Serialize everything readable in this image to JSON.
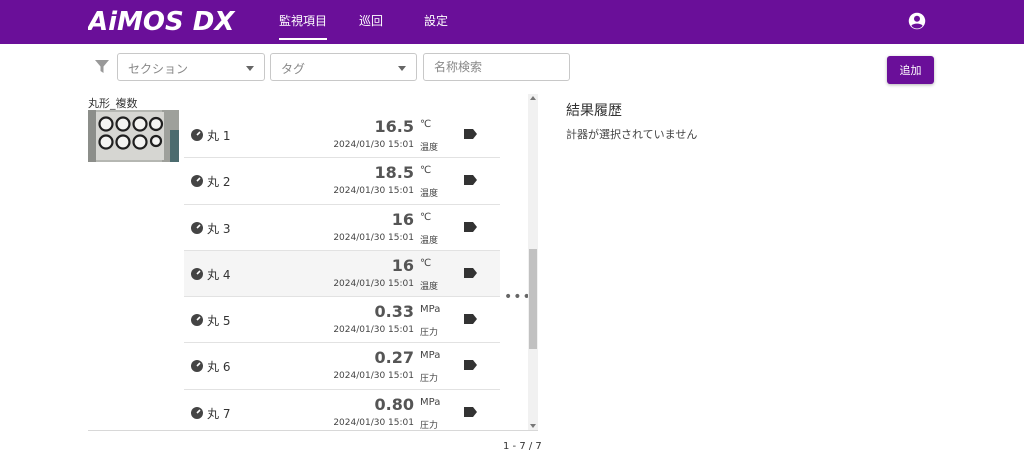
{
  "header": {
    "brand": "AiMOS DX",
    "tabs": [
      {
        "label": "監視項目",
        "active": true
      },
      {
        "label": "巡回",
        "active": false
      },
      {
        "label": "設定",
        "active": false
      }
    ],
    "icons": {
      "account": "account-circle-icon"
    },
    "colors": {
      "bar": "#6a0f99"
    }
  },
  "toolbar": {
    "section_placeholder": "セクション",
    "tag_placeholder": "タグ",
    "search_placeholder": "名称検索",
    "add_label": "追加"
  },
  "list": {
    "group_title": "丸形_複数",
    "rows": [
      {
        "name": "丸 1",
        "value": "16.5",
        "unit": "℃",
        "timestamp": "2024/01/30 15:01",
        "kind": "温度"
      },
      {
        "name": "丸 2",
        "value": "18.5",
        "unit": "℃",
        "timestamp": "2024/01/30 15:01",
        "kind": "温度"
      },
      {
        "name": "丸 3",
        "value": "16",
        "unit": "℃",
        "timestamp": "2024/01/30 15:01",
        "kind": "温度"
      },
      {
        "name": "丸 4",
        "value": "16",
        "unit": "℃",
        "timestamp": "2024/01/30 15:01",
        "kind": "温度"
      },
      {
        "name": "丸 5",
        "value": "0.33",
        "unit": "MPa",
        "timestamp": "2024/01/30 15:01",
        "kind": "圧力"
      },
      {
        "name": "丸 6",
        "value": "0.27",
        "unit": "MPa",
        "timestamp": "2024/01/30 15:01",
        "kind": "圧力"
      },
      {
        "name": "丸 7",
        "value": "0.80",
        "unit": "MPa",
        "timestamp": "2024/01/30 15:01",
        "kind": "圧力"
      }
    ],
    "more": "•••",
    "pagination": "1 - 7 / 7"
  },
  "result": {
    "title": "結果履歴",
    "message": "計器が選択されていません"
  }
}
